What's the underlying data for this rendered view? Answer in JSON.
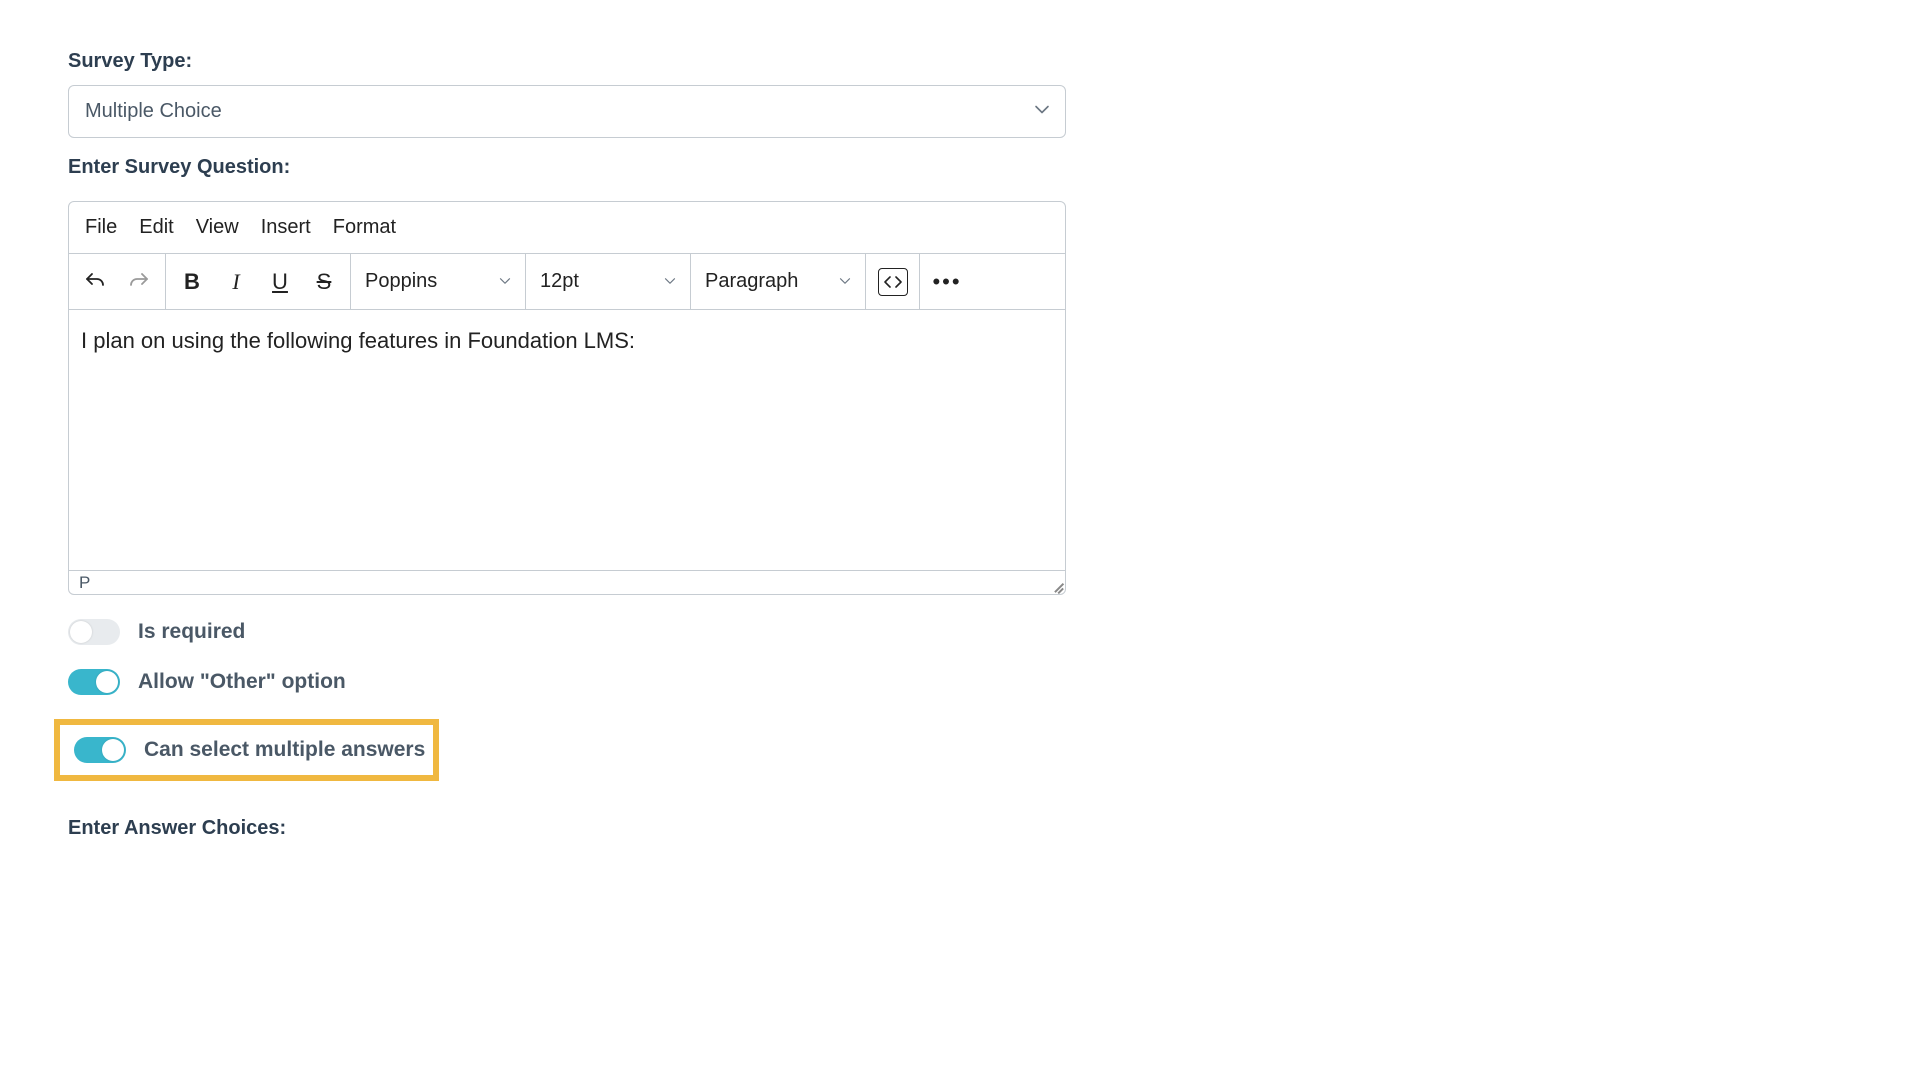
{
  "surveyType": {
    "label": "Survey Type:",
    "value": "Multiple Choice"
  },
  "questionLabel": "Enter Survey Question:",
  "editor": {
    "menus": {
      "file": "File",
      "edit": "Edit",
      "view": "View",
      "insert": "Insert",
      "format": "Format"
    },
    "toolbar": {
      "bold": "B",
      "italic": "I",
      "underline": "U",
      "strike": "S",
      "font": "Poppins",
      "size": "12pt",
      "blockFormat": "Paragraph"
    },
    "content": "I plan on using the following features in Foundation LMS:",
    "statusPath": "P"
  },
  "toggles": {
    "required": {
      "label": "Is required",
      "on": false
    },
    "allowOther": {
      "label": "Allow \"Other\" option",
      "on": true
    },
    "multiAnswer": {
      "label": "Can select multiple answers",
      "on": true
    }
  },
  "choicesLabel": "Enter Answer Choices:"
}
